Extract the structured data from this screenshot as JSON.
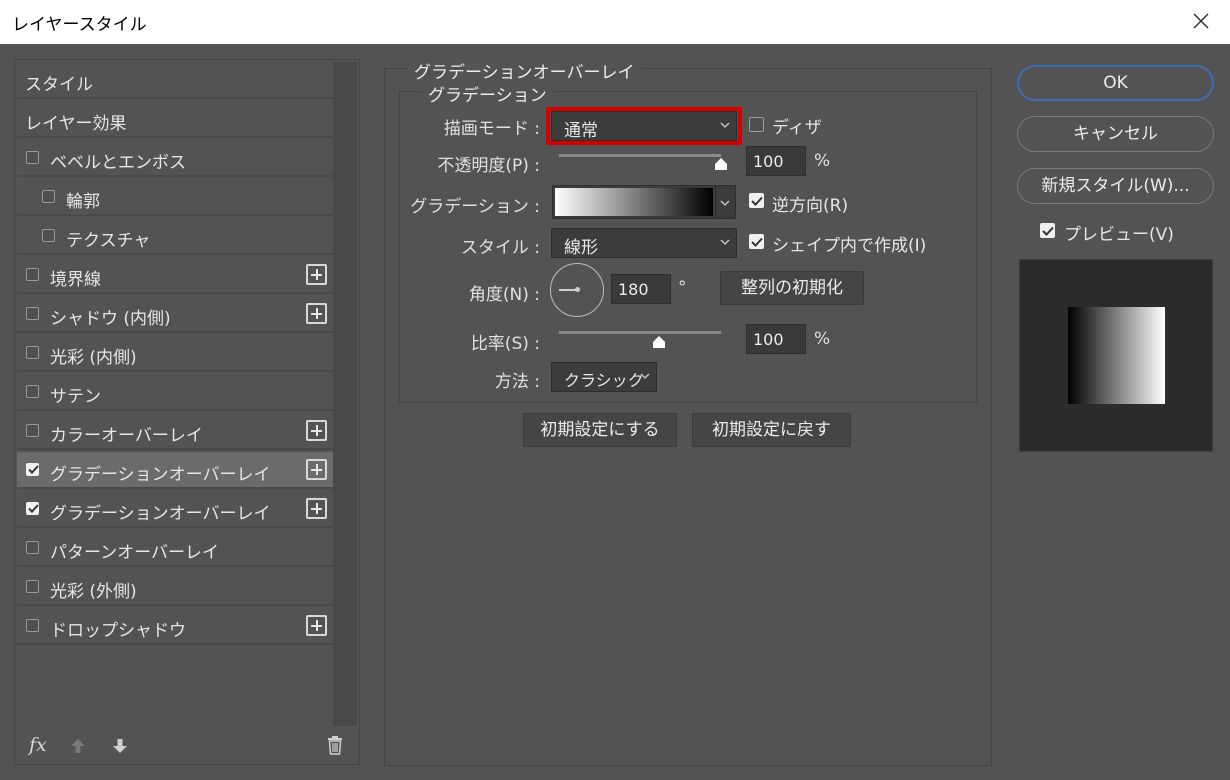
{
  "window": {
    "title": "レイヤースタイル"
  },
  "left_panel": {
    "items": [
      {
        "label": "スタイル",
        "checkbox": false,
        "checked": false,
        "plus": false,
        "selected": false,
        "indent": false
      },
      {
        "label": "レイヤー効果",
        "checkbox": false,
        "checked": false,
        "plus": false,
        "selected": false,
        "indent": false
      },
      {
        "label": "ベベルとエンボス",
        "checkbox": true,
        "checked": false,
        "plus": false,
        "selected": false,
        "indent": false
      },
      {
        "label": "輪郭",
        "checkbox": true,
        "checked": false,
        "plus": false,
        "selected": false,
        "indent": true
      },
      {
        "label": "テクスチャ",
        "checkbox": true,
        "checked": false,
        "plus": false,
        "selected": false,
        "indent": true
      },
      {
        "label": "境界線",
        "checkbox": true,
        "checked": false,
        "plus": true,
        "selected": false,
        "indent": false
      },
      {
        "label": "シャドウ (内側)",
        "checkbox": true,
        "checked": false,
        "plus": true,
        "selected": false,
        "indent": false
      },
      {
        "label": "光彩 (内側)",
        "checkbox": true,
        "checked": false,
        "plus": false,
        "selected": false,
        "indent": false
      },
      {
        "label": "サテン",
        "checkbox": true,
        "checked": false,
        "plus": false,
        "selected": false,
        "indent": false
      },
      {
        "label": "カラーオーバーレイ",
        "checkbox": true,
        "checked": false,
        "plus": true,
        "selected": false,
        "indent": false
      },
      {
        "label": "グラデーションオーバーレイ",
        "checkbox": true,
        "checked": true,
        "plus": true,
        "selected": true,
        "indent": false
      },
      {
        "label": "グラデーションオーバーレイ",
        "checkbox": true,
        "checked": true,
        "plus": true,
        "selected": false,
        "indent": false
      },
      {
        "label": "パターンオーバーレイ",
        "checkbox": true,
        "checked": false,
        "plus": false,
        "selected": false,
        "indent": false
      },
      {
        "label": "光彩 (外側)",
        "checkbox": true,
        "checked": false,
        "plus": false,
        "selected": false,
        "indent": false
      },
      {
        "label": "ドロップシャドウ",
        "checkbox": true,
        "checked": false,
        "plus": true,
        "selected": false,
        "indent": false
      }
    ],
    "bottom": {
      "fx_label": "fx"
    }
  },
  "settings": {
    "group_title": "グラデーションオーバーレイ",
    "subgroup_title": "グラデーション",
    "blend_mode": {
      "label": "描画モード :",
      "value": "通常"
    },
    "dither": {
      "label": "ディザ",
      "checked": false
    },
    "opacity": {
      "label": "不透明度(P) :",
      "value": "100",
      "unit": "%",
      "level": 1.0
    },
    "gradient": {
      "label": "グラデーション :",
      "from_color": "#ffffff",
      "to_color": "#000000"
    },
    "reverse": {
      "label": "逆方向(R)",
      "checked": true
    },
    "style": {
      "label": "スタイル :",
      "value": "線形"
    },
    "align_with_layer": {
      "label": "シェイプ内で作成(I)",
      "checked": true
    },
    "angle": {
      "label": "角度(N) :",
      "value": "180",
      "unit": "°",
      "reset_label": "整列の初期化"
    },
    "scale": {
      "label": "比率(S) :",
      "value": "100",
      "unit": "%",
      "level": 0.62
    },
    "method": {
      "label": "方法 :",
      "value": "クラシック"
    },
    "make_default_label": "初期設定にする",
    "reset_default_label": "初期設定に戻す"
  },
  "right_panel": {
    "ok_label": "OK",
    "cancel_label": "キャンセル",
    "new_style_label": "新規スタイル(W)...",
    "preview": {
      "label": "プレビュー(V)",
      "checked": true
    },
    "colors": {
      "accent": "#3d6fb3",
      "highlight": "#d40000"
    }
  }
}
